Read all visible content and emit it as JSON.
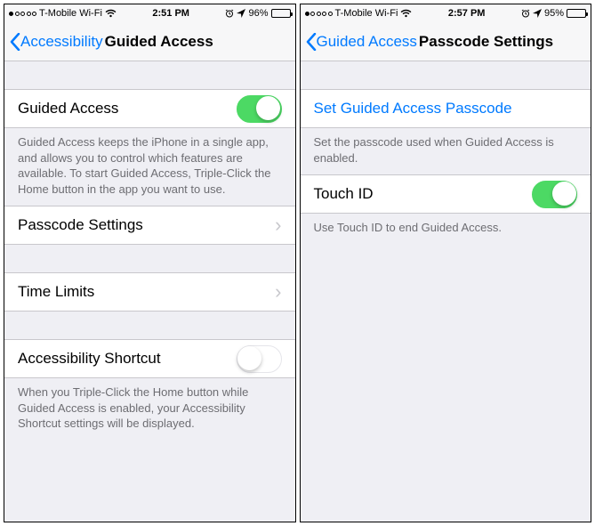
{
  "left": {
    "status": {
      "carrier": "T-Mobile Wi-Fi",
      "time": "2:51 PM",
      "battery_pct": "96%"
    },
    "nav": {
      "back": "Accessibility",
      "title": "Guided Access"
    },
    "rows": {
      "guided_access": {
        "label": "Guided Access",
        "on": true
      },
      "guided_access_footer": "Guided Access keeps the iPhone in a single app, and allows you to control which features are available. To start Guided Access, Triple-Click the Home button in the app you want to use.",
      "passcode_settings": {
        "label": "Passcode Settings"
      },
      "time_limits": {
        "label": "Time Limits"
      },
      "accessibility_shortcut": {
        "label": "Accessibility Shortcut",
        "on": false
      },
      "accessibility_shortcut_footer": "When you Triple-Click the Home button while Guided Access is enabled, your Accessibility Shortcut settings will be displayed."
    }
  },
  "right": {
    "status": {
      "carrier": "T-Mobile Wi-Fi",
      "time": "2:57 PM",
      "battery_pct": "95%"
    },
    "nav": {
      "back": "Guided Access",
      "title": "Passcode Settings"
    },
    "rows": {
      "set_passcode": {
        "label": "Set Guided Access Passcode"
      },
      "set_passcode_footer": "Set the passcode used when Guided Access is enabled.",
      "touch_id": {
        "label": "Touch ID",
        "on": true
      },
      "touch_id_footer": "Use Touch ID to end Guided Access."
    }
  }
}
